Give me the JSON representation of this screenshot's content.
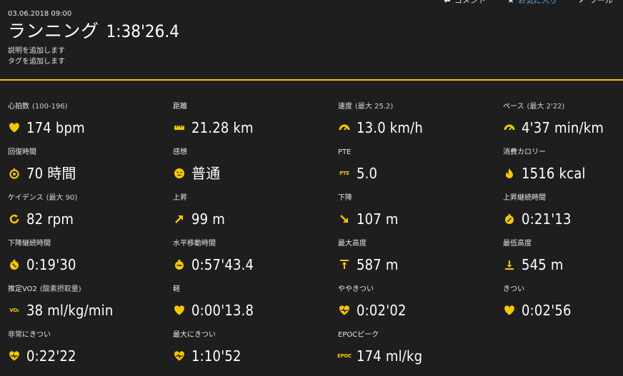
{
  "topbar": {
    "comment": "コメント",
    "favorite": "お気に入り",
    "tools": "ツール"
  },
  "header": {
    "date": "03.06.2018 09:00",
    "activity": "ランニング",
    "duration": "1:38'26.4",
    "add_description": "説明を追加します",
    "add_tags": "タグを追加します"
  },
  "colors": {
    "accent": "#f6c700",
    "background": "#1e1e1e",
    "link": "#5ab0e8"
  },
  "stats": [
    {
      "label": "心拍数",
      "sub": "(100-196)",
      "value": "174 bpm",
      "icon": "heart-icon"
    },
    {
      "label": "距離",
      "sub": "",
      "value": "21.28 km",
      "icon": "ruler-icon"
    },
    {
      "label": "速度",
      "sub": "(最大  25.2)",
      "value": "13.0 km/h",
      "icon": "gauge-icon"
    },
    {
      "label": "ペース",
      "sub": "(最大  2'22)",
      "value": "4'37 min/km",
      "icon": "gauge-icon"
    },
    {
      "label": "回復時間",
      "sub": "",
      "value": "70 時間",
      "icon": "recovery-icon"
    },
    {
      "label": "感想",
      "sub": "",
      "value": "普通",
      "icon": "smiley-icon"
    },
    {
      "label": "PTE",
      "sub": "",
      "value": "5.0",
      "icon": "pte-icon",
      "icon_text": "PTE"
    },
    {
      "label": "消費カロリー",
      "sub": "",
      "value": "1516 kcal",
      "icon": "flame-icon"
    },
    {
      "label": "ケイデンス",
      "sub": "(最大  90)",
      "value": "82 rpm",
      "icon": "cadence-icon"
    },
    {
      "label": "上昇",
      "sub": "",
      "value": "99 m",
      "icon": "arrow-up-right-icon"
    },
    {
      "label": "下降",
      "sub": "",
      "value": "107 m",
      "icon": "arrow-down-right-icon"
    },
    {
      "label": "上昇継続時間",
      "sub": "",
      "value": "0:21'13",
      "icon": "stopwatch-up-icon"
    },
    {
      "label": "下降継続時間",
      "sub": "",
      "value": "0:19'30",
      "icon": "stopwatch-down-icon"
    },
    {
      "label": "水平移動時間",
      "sub": "",
      "value": "0:57'43.4",
      "icon": "stopwatch-flat-icon"
    },
    {
      "label": "最大高度",
      "sub": "",
      "value": "587 m",
      "icon": "max-altitude-icon"
    },
    {
      "label": "最低高度",
      "sub": "",
      "value": "545 m",
      "icon": "min-altitude-icon"
    },
    {
      "label": "推定VO2",
      "sub": "(酸素摂取量)",
      "value": "38 ml/kg/min",
      "icon": "vo2-icon",
      "icon_text": "VO₂"
    },
    {
      "label": "軽",
      "sub": "",
      "value": "0:00'13.8",
      "icon": "heart-icon"
    },
    {
      "label": "ややきつい",
      "sub": "",
      "value": "0:02'02",
      "icon": "heart-pulse-icon"
    },
    {
      "label": "きつい",
      "sub": "",
      "value": "0:02'56",
      "icon": "heart-icon"
    },
    {
      "label": "非常にきつい",
      "sub": "",
      "value": "0:22'22",
      "icon": "heart-pulse-icon"
    },
    {
      "label": "最大にきつい",
      "sub": "",
      "value": "1:10'52",
      "icon": "heart-pulse-icon"
    },
    {
      "label": "EPOCピーク",
      "sub": "",
      "value": "174 ml/kg",
      "icon": "epoc-icon",
      "icon_text": "EPOC"
    }
  ]
}
